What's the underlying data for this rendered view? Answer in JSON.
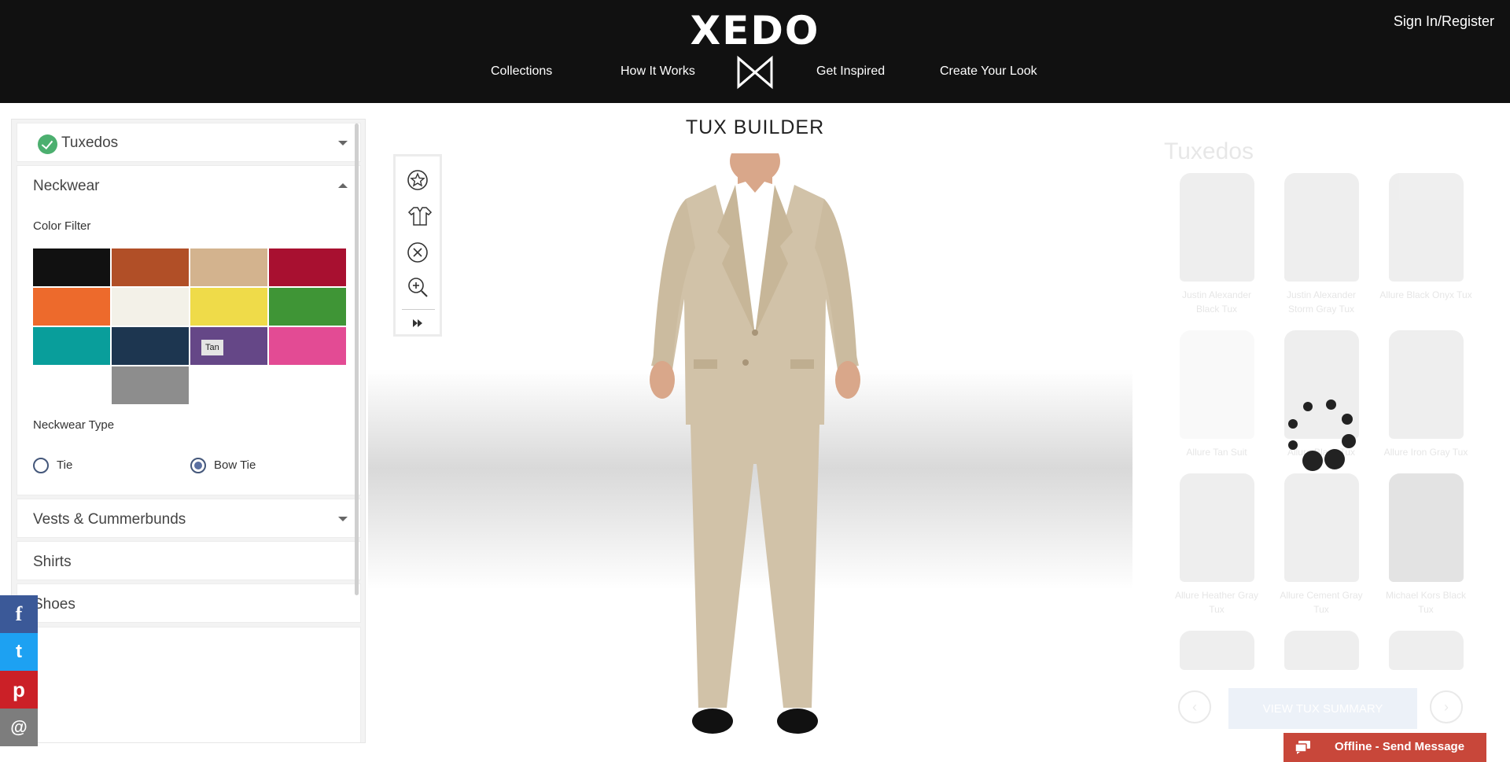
{
  "brand": {
    "logo": "XEDO"
  },
  "header": {
    "signin": "Sign In/Register",
    "nav": [
      "Collections",
      "How It Works",
      "Get Inspired",
      "Create Your Look"
    ]
  },
  "builder": {
    "title": "TUX BUILDER"
  },
  "left": {
    "sections": {
      "tuxedos": "Tuxedos",
      "neckwear": "Neckwear",
      "vests": "Vests & Cummerbunds",
      "shirts": "Shirts",
      "shoes": "Shoes"
    },
    "color_filter_label": "Color Filter",
    "hover_tooltip": "Tan",
    "colors": [
      "#111111",
      "#b14f27",
      "#d3b38e",
      "#a81030",
      "#ed6a2c",
      "#f3f1e8",
      "#efdb49",
      "#3f9536",
      "#099e9b",
      "#1d3650",
      "#654787",
      "#e34b94",
      "#8d8d8d"
    ],
    "neckwear_type_label": "Neckwear Type",
    "options": [
      {
        "label": "Tie",
        "checked": false
      },
      {
        "label": "Bow Tie",
        "checked": true
      }
    ]
  },
  "right": {
    "title": "Tuxedos",
    "products": [
      "Justin Alexander Black Tux",
      "Justin Alexander Storm Gray Tux",
      "Allure Black Onyx Tux",
      "Allure Tan Suit",
      "Allure Black Tux",
      "Allure Iron Gray Tux",
      "Allure Heather Gray Tux",
      "Allure Cement Gray Tux",
      "Michael Kors Black Tux"
    ],
    "summary_button": "VIEW TUX SUMMARY"
  },
  "chat": {
    "label": "Offline - Send Message"
  },
  "social": [
    "f",
    "t",
    "p",
    "@"
  ]
}
